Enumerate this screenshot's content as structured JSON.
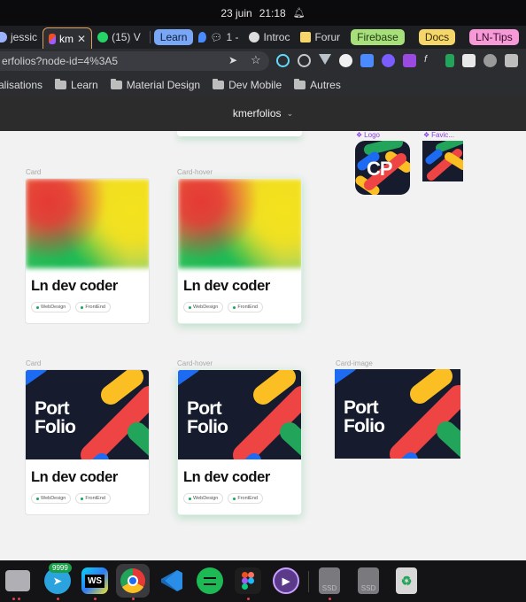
{
  "os_bar": {
    "date": "23 juin",
    "time": "21:18"
  },
  "tabs": [
    {
      "label": "jessic",
      "favicon_color": "#9ab3ff",
      "active": false
    },
    {
      "label": "km",
      "favicon_color": "#f24e1e",
      "active": true,
      "close": "✕"
    },
    {
      "label": "(15) V",
      "favicon_color": "#25d366",
      "active": false
    }
  ],
  "tab_groups": {
    "learn": "Learn",
    "firebase": "Firebase",
    "docs": "Docs",
    "lntips": "LN-Tips"
  },
  "group_tabs": [
    {
      "label": "1 -",
      "favicon_color": "#4a8cff"
    },
    {
      "label": "Introc",
      "favicon_color": "#dddddd"
    },
    {
      "label": "Forur",
      "favicon_color": "#f5d66b"
    }
  ],
  "address_bar": {
    "url": "erfolios?node-id=4%3A5"
  },
  "bookmarks": [
    {
      "label": "alisations",
      "folder": false
    },
    {
      "label": "Learn",
      "folder": true
    },
    {
      "label": "Material Design",
      "folder": true
    },
    {
      "label": "Dev Mobile",
      "folder": true
    },
    {
      "label": "Autres",
      "folder": true
    }
  ],
  "figma": {
    "file_name": "kmerfolios"
  },
  "canvas": {
    "labels": {
      "card_1": "Card",
      "card_hover_1": "Card-hover",
      "card_2": "Card",
      "card_hover_2": "Card-hover",
      "card_image": "Card-image",
      "logo": "Logo",
      "favicon": "Favic..."
    },
    "logo_text": "CP",
    "card_title": "Ln dev coder",
    "tags": [
      "WebDesign",
      "FrontEnd"
    ],
    "portfolio_text": [
      "Port",
      "Folio"
    ]
  },
  "dock": {
    "badge": "9999",
    "ws_label": "WS",
    "ssd_label": "SSD"
  },
  "colors": {
    "red": "#ef4444",
    "yellow": "#fbbf24",
    "green": "#22a55a",
    "blue": "#1d6bf3",
    "dark": "#161b2e"
  }
}
